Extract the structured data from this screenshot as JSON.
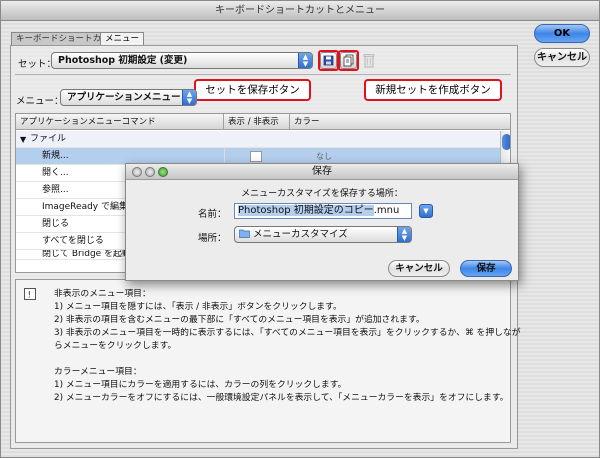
{
  "window": {
    "title": "キーボードショートカットとメニュー"
  },
  "tabs": [
    {
      "label": "キーボードショートカット",
      "active": false
    },
    {
      "label": "メニュー",
      "active": true
    }
  ],
  "set": {
    "label": "セット：",
    "value": "Photoshop 初期設定 (変更)"
  },
  "callouts": {
    "save": "セットを保存ボタン",
    "new": "新規セットを作成ボタン"
  },
  "menu": {
    "label": "メニュー：",
    "value": "アプリケーションメニュー"
  },
  "table": {
    "headers": [
      "アプリケーションメニューコマンド",
      "表示 / 非表示",
      "カラー"
    ],
    "group": "ファイル",
    "rows": [
      {
        "label": "新規...",
        "color": "なし",
        "selected": true
      },
      {
        "label": "開く...",
        "color": "",
        "selected": false
      },
      {
        "label": "参照...",
        "color": "",
        "selected": false
      },
      {
        "label": "ImageReady で編集",
        "color": "",
        "selected": false
      },
      {
        "label": "閉じる",
        "color": "",
        "selected": false
      },
      {
        "label": "すべてを閉じる",
        "color": "",
        "selected": false
      },
      {
        "label": "閉じて Bridge を起動",
        "color": "",
        "selected": false
      }
    ]
  },
  "info": {
    "lines": [
      "非表示のメニュー項目：",
      "1) メニュー項目を隠すには、「表示 / 非表示」ボタンをクリックします。",
      "2) 非表示の項目を含むメニューの最下部に「すべてのメニュー項目を表示」が追加されます。",
      "3) 非表示のメニュー項目を一時的に表示するには、「すべてのメニュー項目を表示」をクリックするか、⌘ を押しなが",
      "らメニューをクリックします。",
      "",
      "カラーメニュー項目：",
      "1) メニュー項目にカラーを適用するには、カラーの列をクリックします。",
      "2) メニューカラーをオフにするには、一般環境設定パネルを表示して、「メニューカラーを表示」をオフにします。"
    ]
  },
  "buttons": {
    "ok": "OK",
    "cancel": "キャンセル"
  },
  "dialog": {
    "title": "保存",
    "prompt": "メニューカスタマイズを保存する場所：",
    "name_label": "名前：",
    "name_selected": "Photoshop 初期設定のコピー",
    "name_ext": ".mnu",
    "where_label": "場所：",
    "where_value": "メニューカスタマイズ",
    "cancel": "キャンセル",
    "save": "保存"
  },
  "colors": {
    "callout_border": "#e0101c",
    "selection": "#b4cfee",
    "accent_blue": "#3d86e8"
  }
}
